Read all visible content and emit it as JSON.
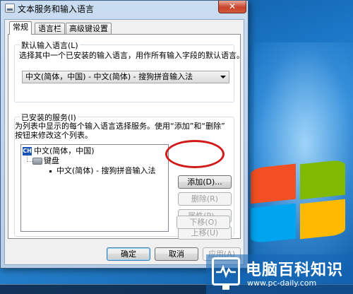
{
  "window": {
    "title": "文本服务和输入语言",
    "close_glyph": "✕"
  },
  "tabs": [
    {
      "label": "常规",
      "active": true
    },
    {
      "label": "语言栏",
      "active": false
    },
    {
      "label": "高级键设置",
      "active": false
    }
  ],
  "default_language": {
    "group_label": "默认输入语言(L)",
    "description": "选择其中一个已安装的输入语言，用作所有输入字段的默认语言。",
    "selected": "中文(简体，中国) - 中文(简体) - 搜狗拼音输入法"
  },
  "installed_services": {
    "group_label": "已安装的服务(I)",
    "description_line1": "为列表中显示的每个输入语言选择服务。使用“添加”和“删除”",
    "description_line2": "按钮来修改这个列表。",
    "tree": {
      "language_code": "CH",
      "language": "中文(简体，中国)",
      "category": "键盘",
      "service": "中文(简体) - 搜狗拼音输入法"
    },
    "buttons": {
      "add": "添加(D)...",
      "remove": "删除(R)",
      "properties": "属性(P)...",
      "move_up": "上移(U)",
      "move_down": "下移(O)"
    }
  },
  "footer": {
    "ok": "确定",
    "cancel": "取消",
    "apply": "应用(A)"
  },
  "watermark": {
    "title": "电脑百科知识",
    "url": "www.pc-daily.com"
  },
  "colors": {
    "highlight_circle": "#d11a1a",
    "language_badge": "#1b52b5"
  }
}
